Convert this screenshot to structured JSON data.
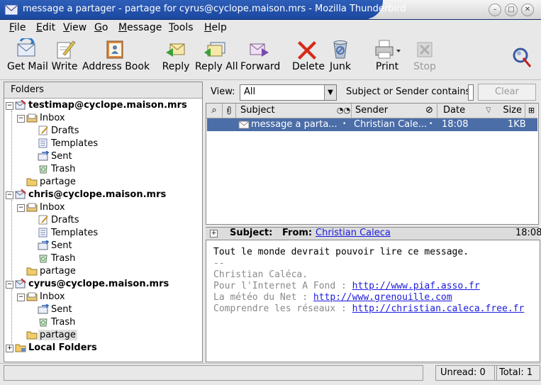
{
  "window": {
    "title": "message a partager - partage for cyrus@cyclope.maison.mrs - Mozilla Thunderbird"
  },
  "menu": [
    {
      "label": "File",
      "u": "F",
      "rest": "ile"
    },
    {
      "label": "Edit",
      "u": "E",
      "rest": "dit"
    },
    {
      "label": "View",
      "u": "V",
      "rest": "iew"
    },
    {
      "label": "Go",
      "u": "G",
      "rest": "o"
    },
    {
      "label": "Message",
      "u": "M",
      "rest": "essage"
    },
    {
      "label": "Tools",
      "u": "T",
      "rest": "ools"
    },
    {
      "label": "Help",
      "u": "H",
      "rest": "elp"
    }
  ],
  "toolbar": {
    "get_mail": "Get Mail",
    "write": "Write",
    "address_book": "Address Book",
    "reply": "Reply",
    "reply_all": "Reply All",
    "forward": "Forward",
    "delete": "Delete",
    "junk": "Junk",
    "print": "Print",
    "stop": "Stop"
  },
  "folders": {
    "header": "Folders",
    "accounts": [
      {
        "name": "testimap@cyclope.maison.mrs",
        "inbox": "Inbox",
        "subfolders": [
          "Drafts",
          "Templates",
          "Sent",
          "Trash"
        ],
        "extra": "partage"
      },
      {
        "name": "chris@cyclope.maison.mrs",
        "inbox": "Inbox",
        "subfolders": [
          "Drafts",
          "Templates",
          "Sent",
          "Trash"
        ],
        "extra": "partage"
      },
      {
        "name": "cyrus@cyclope.maison.mrs",
        "inbox": "Inbox",
        "subfolders": [
          "Sent",
          "Trash"
        ],
        "extra": "partage"
      }
    ],
    "local": "Local Folders"
  },
  "view_filter": {
    "view_label": "View:",
    "view_value": "All",
    "search_label": "Subject or Sender contains:",
    "clear": "Clear"
  },
  "thread_columns": {
    "subject": "Subject",
    "sender": "Sender",
    "date": "Date",
    "size": "Size"
  },
  "messages": [
    {
      "subject": "message a parta...",
      "sender": "Christian Cale...",
      "date": "18:08",
      "size": "1KB"
    }
  ],
  "preview": {
    "subject_label": "Subject:",
    "from_label": "From:",
    "from_value": "Christian Caleca",
    "time": "18:08",
    "body": "Tout le monde devrait pouvoir lire ce message.",
    "sig_sep": "--",
    "sig_name": "Christian Caléca.",
    "sig1_text": "Pour l'Internet A Fond : ",
    "sig1_link": "http://www.piaf.asso.fr",
    "sig2_text": "La météo du Net : ",
    "sig2_link": "http://www.grenouille.com",
    "sig3_text": "Comprendre les réseaux : ",
    "sig3_link": "http://christian.caleca.free.fr"
  },
  "status": {
    "unread": "Unread: 0",
    "total": "Total: 1"
  }
}
